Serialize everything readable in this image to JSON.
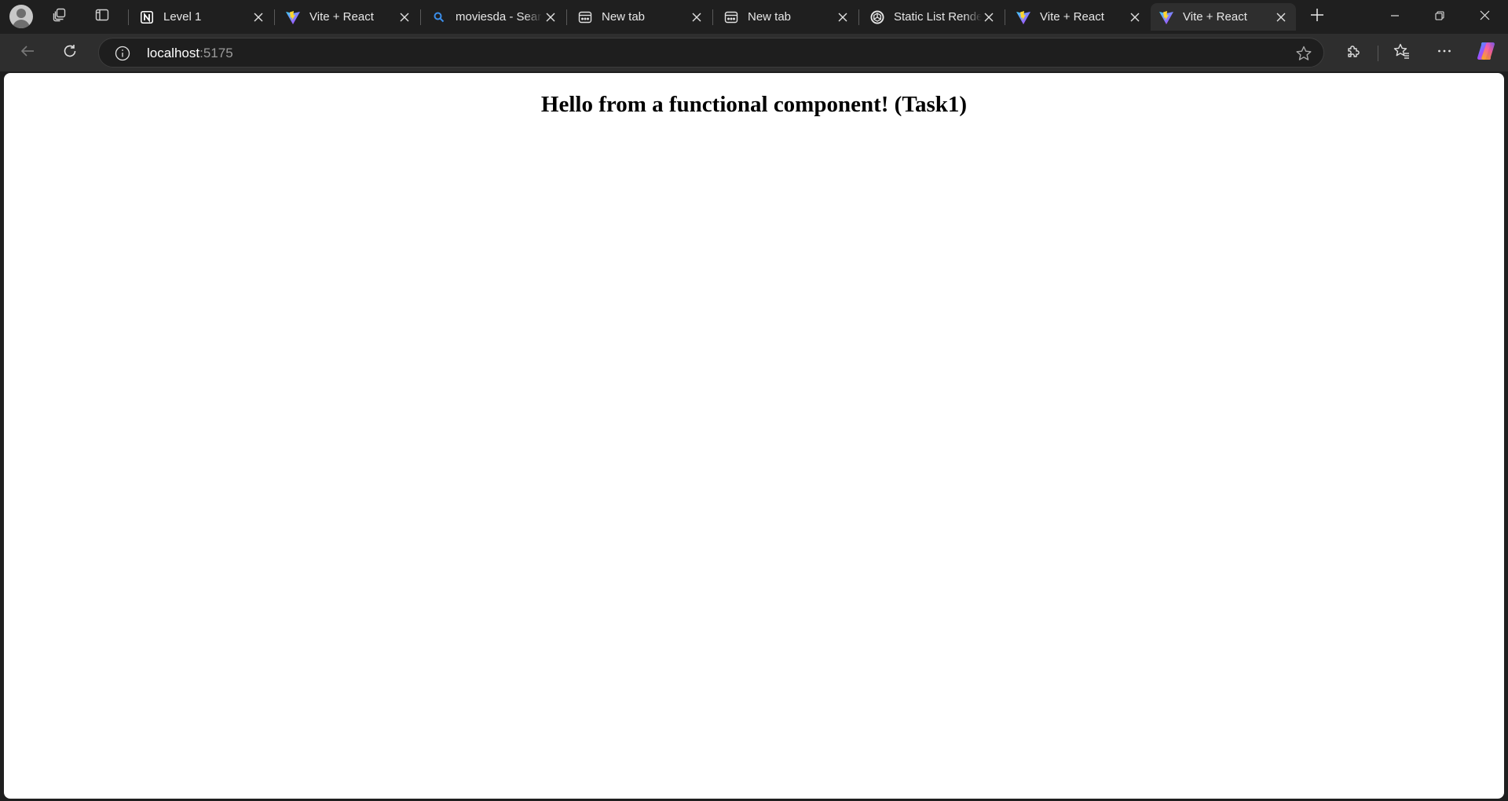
{
  "browser": {
    "tabs": [
      {
        "title": "Level 1",
        "favicon": "notion-icon",
        "active": false
      },
      {
        "title": "Vite + React",
        "favicon": "vite-icon",
        "active": false
      },
      {
        "title": "moviesda - Search",
        "favicon": "search-icon",
        "active": false
      },
      {
        "title": "New tab",
        "favicon": "newtab-icon",
        "active": false
      },
      {
        "title": "New tab",
        "favicon": "newtab-icon",
        "active": false
      },
      {
        "title": "Static List Rendering",
        "favicon": "openai-icon",
        "active": false
      },
      {
        "title": "Vite + React",
        "favicon": "vite-icon",
        "active": false
      },
      {
        "title": "Vite + React",
        "favicon": "vite-icon",
        "active": true
      }
    ],
    "address_bar": {
      "host": "localhost",
      "port": ":5175"
    }
  },
  "page": {
    "heading": "Hello from a functional component! (Task1)"
  },
  "colors": {
    "chrome_dark": "#1f1f1f",
    "toolbar": "#2e2e2e",
    "page_background": "#ffffff"
  }
}
